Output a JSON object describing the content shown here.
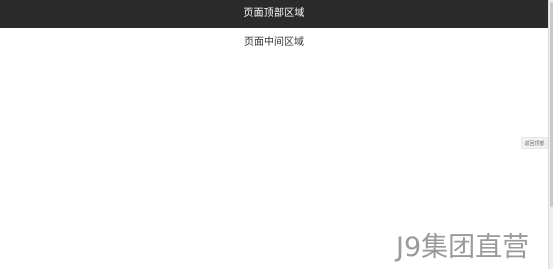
{
  "header": {
    "title": "页面顶部区域"
  },
  "main": {
    "center_label": "页面中间区域"
  },
  "back_to_top": {
    "label": "返回顶部"
  },
  "watermark": {
    "text": "J9集团直营"
  },
  "colors": {
    "header_bg": "#2b2b2b",
    "header_text": "#ffffff",
    "body_bg": "#ffffff",
    "watermark": "#9a9a9a"
  }
}
